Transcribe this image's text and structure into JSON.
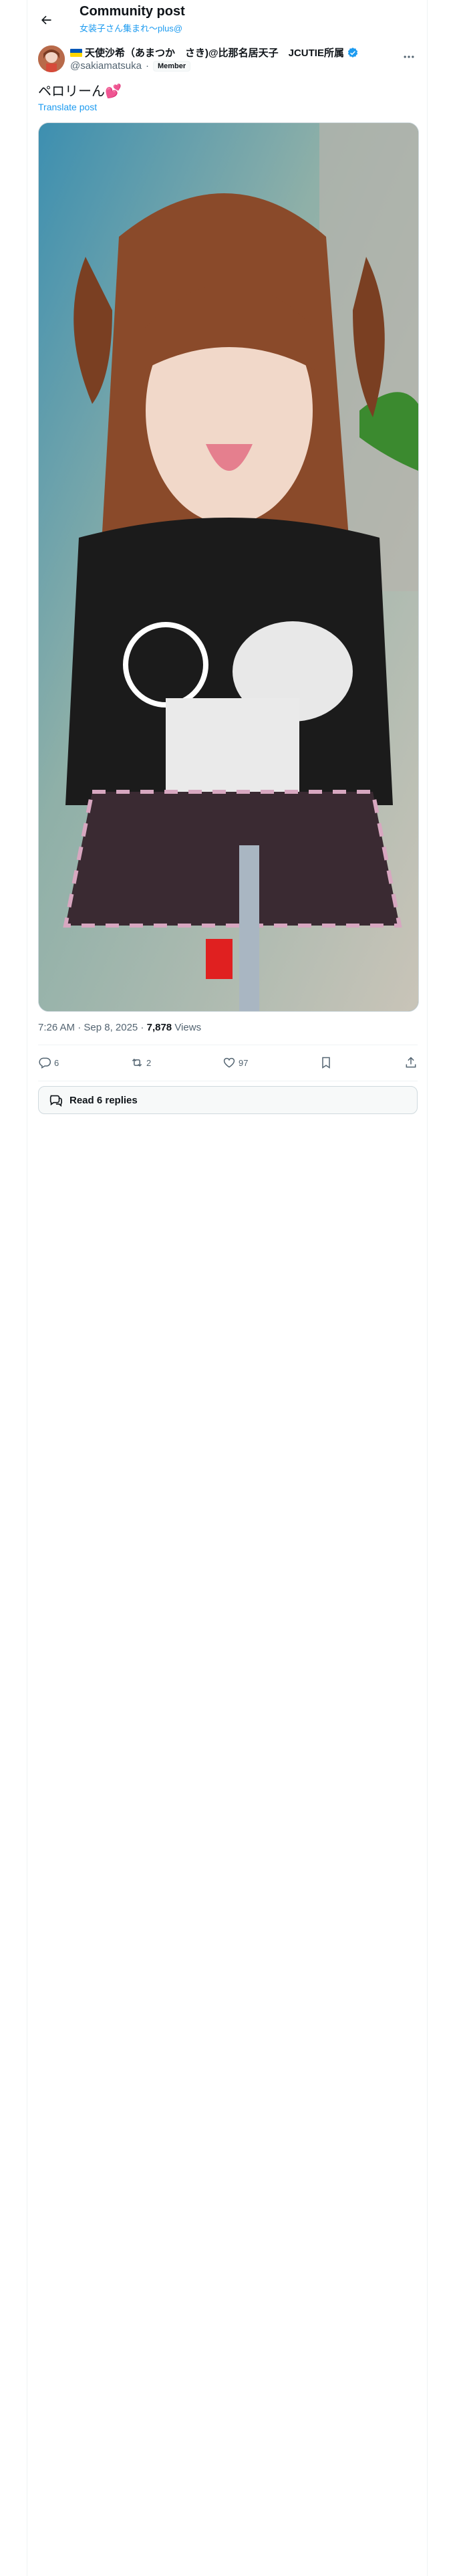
{
  "header": {
    "title": "Community post",
    "community": "女装子さん集まれ〜plus@"
  },
  "post": {
    "display_name": "天使沙希（あまつか　さき)@比那名居天子　JCUTIE所属",
    "handle": "@sakiamatsuka",
    "separator": "·",
    "member_badge": "Member",
    "text": "ペロリーん💕",
    "translate_label": "Translate post",
    "time": "7:26 AM · Sep 8, 2025 · ",
    "views_count": "7,878",
    "views_label": " Views"
  },
  "actions": {
    "replies": "6",
    "reposts": "2",
    "likes": "97"
  },
  "read_replies": "Read 6 replies",
  "icons": [
    "back-arrow-icon",
    "flag-icon",
    "verified-icon",
    "more-icon",
    "reply-icon",
    "repost-icon",
    "like-icon",
    "bookmark-icon",
    "share-icon",
    "speech-bubbles-icon"
  ],
  "colors": {
    "accent": "#1d9bf0",
    "muted": "#536471",
    "text": "#0f1419"
  }
}
